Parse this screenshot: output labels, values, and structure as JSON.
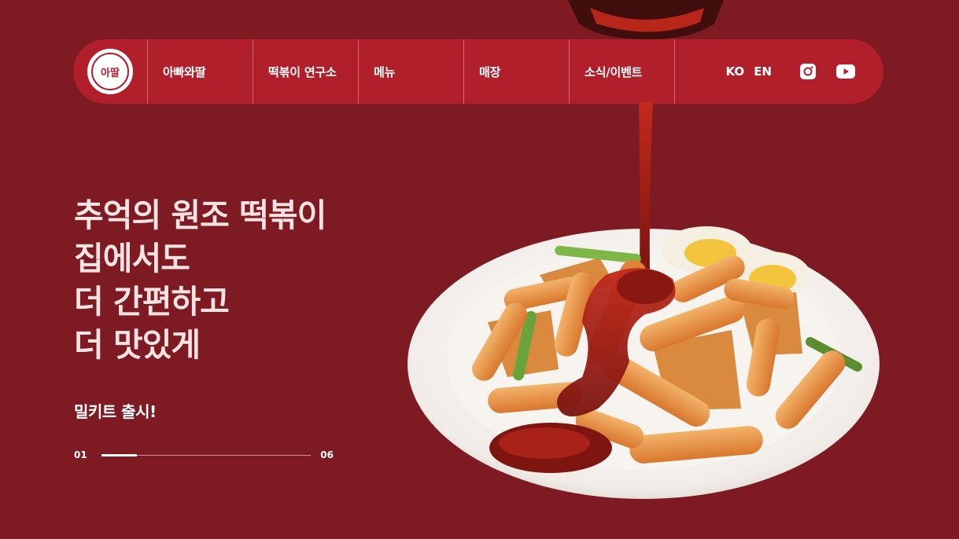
{
  "theme": {
    "background": "#7d1a22",
    "nav_bg": "#b01f2a",
    "accent": "#fbe3e3"
  },
  "nav": {
    "logo_text": "아딸",
    "items": [
      {
        "label": "아빠와딸"
      },
      {
        "label": "떡볶이 연구소"
      },
      {
        "label": "메뉴"
      },
      {
        "label": "매장"
      },
      {
        "label": "소식/이벤트"
      }
    ],
    "languages": [
      "KO",
      "EN"
    ],
    "social_icons": [
      "instagram-icon",
      "youtube-icon"
    ]
  },
  "hero": {
    "lines": [
      "추억의 원조 떡볶이",
      "집에서도",
      "더 간편하고",
      "더 맛있게"
    ],
    "subtitle": "밀키트 출시!"
  },
  "slider": {
    "current": "01",
    "total": "06",
    "progress": 0.17
  }
}
